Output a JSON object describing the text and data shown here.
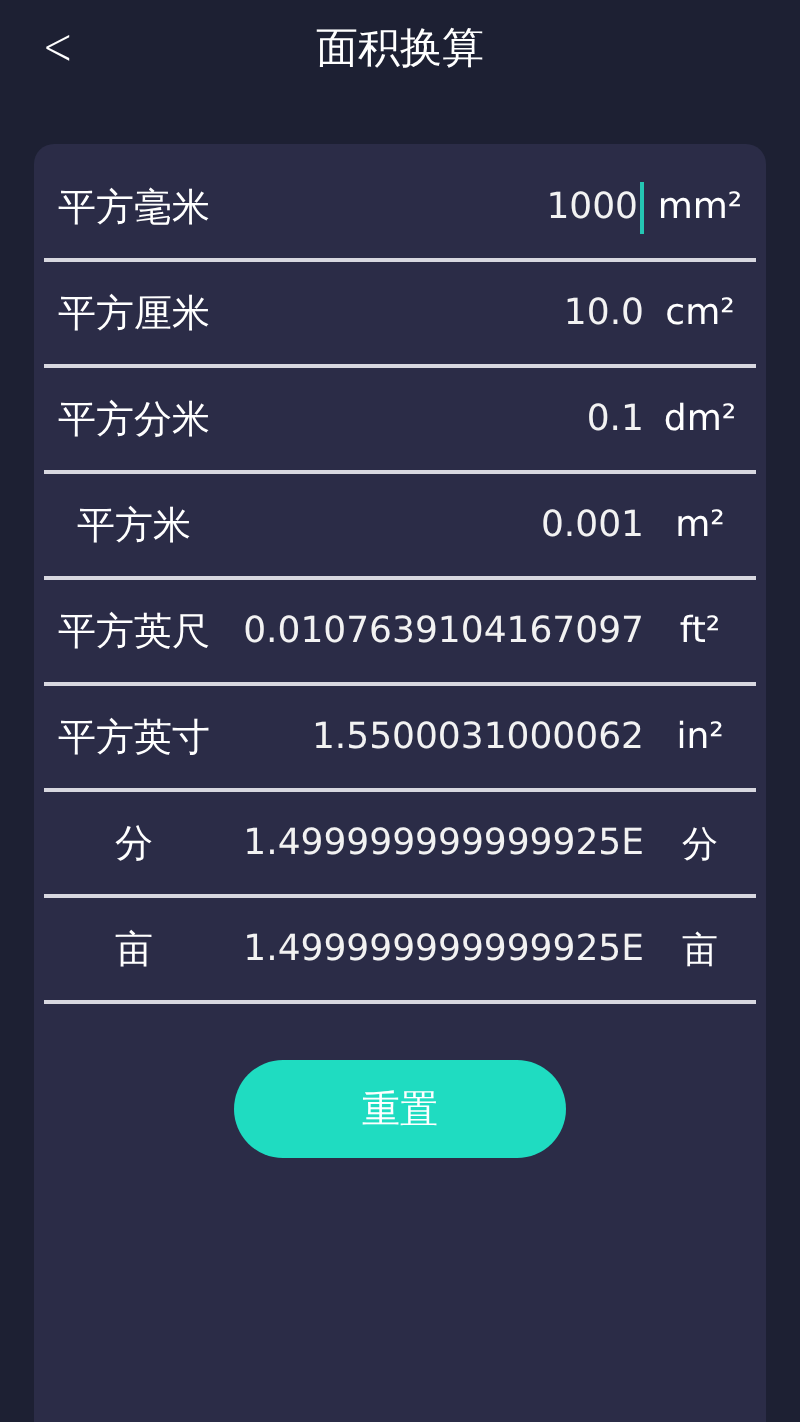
{
  "header": {
    "back": "<",
    "title": "面积换算"
  },
  "rows": [
    {
      "label": "平方毫米",
      "value": "1000",
      "unit": "mm²",
      "focused": true
    },
    {
      "label": "平方厘米",
      "value": "10.0",
      "unit": "cm²",
      "focused": false
    },
    {
      "label": "平方分米",
      "value": "0.1",
      "unit": "dm²",
      "focused": false
    },
    {
      "label": "平方米",
      "value": "0.001",
      "unit": "m²",
      "focused": false
    },
    {
      "label": "平方英尺",
      "value": "0.0107639104167097",
      "unit": "ft²",
      "focused": false
    },
    {
      "label": "平方英寸",
      "value": "1.5500031000062",
      "unit": "in²",
      "focused": false
    },
    {
      "label": "分",
      "value": "1.499999999999925E",
      "unit": "分",
      "focused": false
    },
    {
      "label": "亩",
      "value": "1.499999999999925E",
      "unit": "亩",
      "focused": false
    }
  ],
  "reset_button": "重置"
}
